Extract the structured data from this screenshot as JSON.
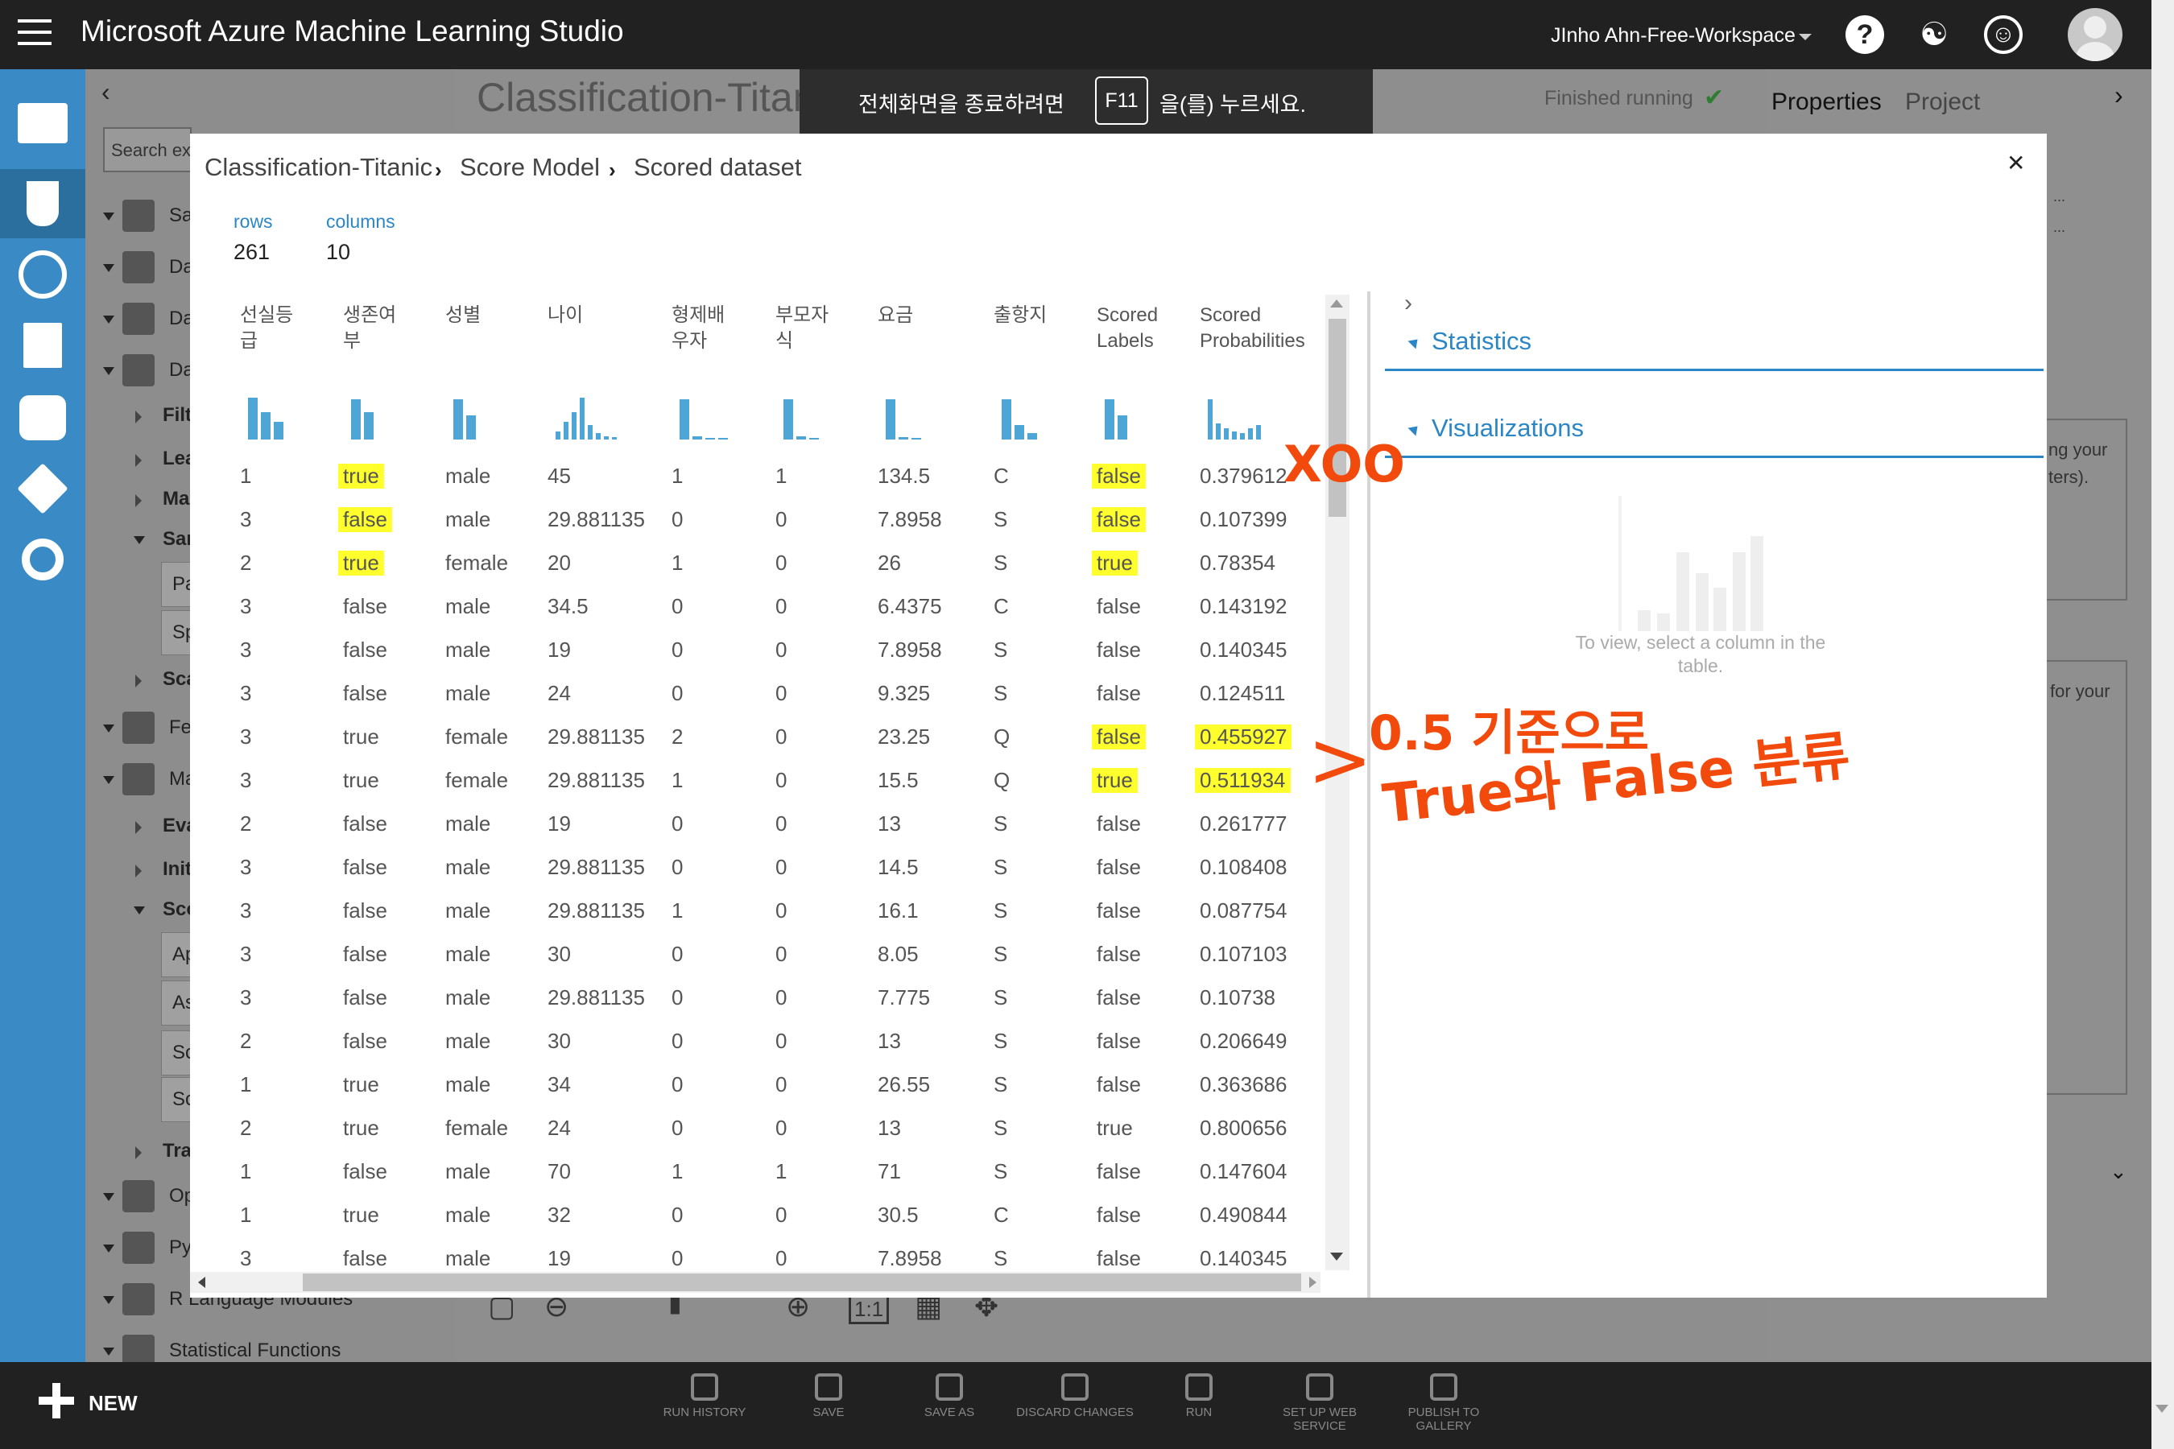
{
  "app": {
    "title": "Microsoft Azure Machine Learning Studio",
    "workspace": "JInho Ahn-Free-Workspace"
  },
  "topbar_icons": [
    "help-icon",
    "community-icon",
    "smiley-icon",
    "avatar"
  ],
  "fullscreen_notice": {
    "before": "전체화면을 종료하려면",
    "key": "F11",
    "after": "을(를) 누르세요."
  },
  "palette": {
    "search_placeholder": "Search ex",
    "items": [
      "Sa",
      "Da",
      "Da",
      "Da",
      "Filt",
      "Lea",
      "Ma",
      "Sar",
      "Pa",
      "Sp",
      "Sca",
      "Fe",
      "Ma",
      "Eva",
      "Init",
      "Sco",
      "Ap",
      "As",
      "Sc",
      "Sc",
      "Tra",
      "Op",
      "Py",
      "R Language Modules",
      "Statistical Functions"
    ]
  },
  "experiment": {
    "title": "Classification-Titanic",
    "status": "Finished running"
  },
  "right_panel": {
    "tabs": [
      "Properties",
      "Project"
    ],
    "text1a": "ng your",
    "text1b": "ters).",
    "text2": "for your"
  },
  "bottom_bar": {
    "new_label": "NEW",
    "actions": [
      "RUN HISTORY",
      "SAVE",
      "SAVE AS",
      "DISCARD CHANGES",
      "RUN",
      "SET UP WEB SERVICE",
      "PUBLISH TO GALLERY"
    ]
  },
  "modal": {
    "breadcrumb": [
      "Classification-Titanic",
      "Score Model",
      "Scored dataset"
    ],
    "rows_label": "rows",
    "rows_value": "261",
    "columns_label": "columns",
    "columns_value": "10",
    "headers": [
      [
        "선실등",
        "급"
      ],
      [
        "생존여",
        "부"
      ],
      [
        "성별",
        ""
      ],
      [
        "나이",
        ""
      ],
      [
        "형제배",
        "우자"
      ],
      [
        "부모자",
        "식"
      ],
      [
        "요금",
        ""
      ],
      [
        "출항지",
        ""
      ],
      [
        "Scored",
        "Labels"
      ],
      [
        "Scored",
        "Probabilities"
      ]
    ],
    "rows": [
      [
        "1",
        "true",
        "male",
        "45",
        "1",
        "1",
        "134.5",
        "C",
        "false",
        "0.379612"
      ],
      [
        "3",
        "false",
        "male",
        "29.881135",
        "0",
        "0",
        "7.8958",
        "S",
        "false",
        "0.107399"
      ],
      [
        "2",
        "true",
        "female",
        "20",
        "1",
        "0",
        "26",
        "S",
        "true",
        "0.78354"
      ],
      [
        "3",
        "false",
        "male",
        "34.5",
        "0",
        "0",
        "6.4375",
        "C",
        "false",
        "0.143192"
      ],
      [
        "3",
        "false",
        "male",
        "19",
        "0",
        "0",
        "7.8958",
        "S",
        "false",
        "0.140345"
      ],
      [
        "3",
        "false",
        "male",
        "24",
        "0",
        "0",
        "9.325",
        "S",
        "false",
        "0.124511"
      ],
      [
        "3",
        "true",
        "female",
        "29.881135",
        "2",
        "0",
        "23.25",
        "Q",
        "false",
        "0.455927"
      ],
      [
        "3",
        "true",
        "female",
        "29.881135",
        "1",
        "0",
        "15.5",
        "Q",
        "true",
        "0.511934"
      ],
      [
        "2",
        "false",
        "male",
        "19",
        "0",
        "0",
        "13",
        "S",
        "false",
        "0.261777"
      ],
      [
        "3",
        "false",
        "male",
        "29.881135",
        "0",
        "0",
        "14.5",
        "S",
        "false",
        "0.108408"
      ],
      [
        "3",
        "false",
        "male",
        "29.881135",
        "1",
        "0",
        "16.1",
        "S",
        "false",
        "0.087754"
      ],
      [
        "3",
        "false",
        "male",
        "30",
        "0",
        "0",
        "8.05",
        "S",
        "false",
        "0.107103"
      ],
      [
        "3",
        "false",
        "male",
        "29.881135",
        "0",
        "0",
        "7.775",
        "S",
        "false",
        "0.10738"
      ],
      [
        "2",
        "false",
        "male",
        "30",
        "0",
        "0",
        "13",
        "S",
        "false",
        "0.206649"
      ],
      [
        "1",
        "true",
        "male",
        "34",
        "0",
        "0",
        "26.55",
        "S",
        "false",
        "0.363686"
      ],
      [
        "2",
        "true",
        "female",
        "24",
        "0",
        "0",
        "13",
        "S",
        "true",
        "0.800656"
      ],
      [
        "1",
        "false",
        "male",
        "70",
        "1",
        "1",
        "71",
        "S",
        "false",
        "0.147604"
      ],
      [
        "1",
        "true",
        "male",
        "32",
        "0",
        "0",
        "30.5",
        "C",
        "false",
        "0.490844"
      ],
      [
        "3",
        "false",
        "male",
        "19",
        "0",
        "0",
        "7.8958",
        "S",
        "false",
        "0.140345"
      ]
    ],
    "highlighted": [
      [
        0,
        1
      ],
      [
        0,
        8
      ],
      [
        1,
        1
      ],
      [
        1,
        8
      ],
      [
        2,
        1
      ],
      [
        2,
        8
      ],
      [
        6,
        8
      ],
      [
        6,
        9
      ],
      [
        7,
        8
      ],
      [
        7,
        9
      ]
    ],
    "statistics_label": "Statistics",
    "visualizations_label": "Visualizations",
    "viz_hint": "To view, select a column in the table."
  },
  "annotations": {
    "marks": "XOO",
    "line1": "0.5 기준으로",
    "line2": "True와 False 분류",
    "color": "#f24a0c"
  },
  "colors": {
    "highlight": "#ffff2e",
    "accent": "#2b86c6",
    "nav": "#3a8bc5",
    "topbar": "#212121"
  }
}
